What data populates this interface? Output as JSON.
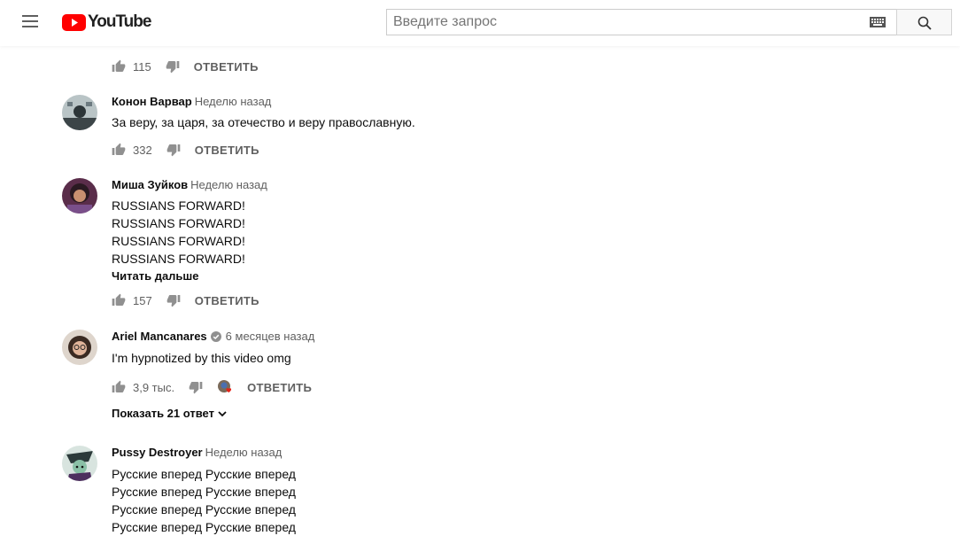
{
  "header": {
    "logo_text": "YouTube",
    "search_placeholder": "Введите запрос"
  },
  "colors": {
    "brand_red": "#ff0000",
    "secondary_text": "#606060",
    "primary_text": "#0d0d0d"
  },
  "top_action_bar": {
    "likes": "115",
    "reply_label": "ОТВЕТИТЬ"
  },
  "comments": [
    {
      "author": "Конон Варвар",
      "time": "Неделю назад",
      "lines": [
        "За веру, за царя, за отечество и веру православную."
      ],
      "likes": "332",
      "reply_label": "ОТВЕТИТЬ"
    },
    {
      "author": "Миша Зуйков",
      "time": "Неделю назад",
      "lines": [
        "RUSSIANS FORWARD!",
        "RUSSIANS FORWARD!",
        "RUSSIANS FORWARD!",
        "RUSSIANS FORWARD!"
      ],
      "read_more": "Читать дальше",
      "likes": "157",
      "reply_label": "ОТВЕТИТЬ"
    },
    {
      "author": "Ariel Mancanares",
      "verified": true,
      "time": "6 месяцев назад",
      "lines": [
        "I'm hypnotized by this video omg"
      ],
      "likes": "3,9 тыс.",
      "reply_label": "ОТВЕТИТЬ",
      "show_replies": "Показать 21 ответ"
    },
    {
      "author": "Pussy Destroyer",
      "time": "Неделю назад",
      "lines": [
        "Русские вперед Русские вперед",
        "Русские вперед Русские вперед",
        "Русские вперед Русские вперед",
        "Русские вперед Русские вперед"
      ]
    }
  ]
}
